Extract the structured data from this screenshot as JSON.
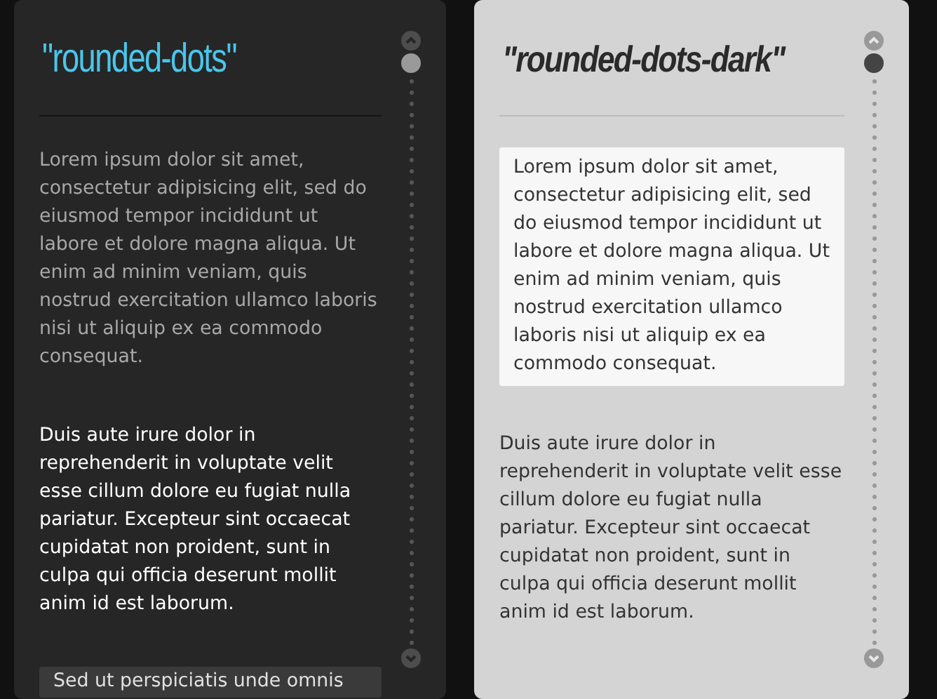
{
  "panels": [
    {
      "kind": "dark",
      "title": "\"rounded-dots\"",
      "blocks": [
        {
          "kind": "muted",
          "text": "Lorem ipsum dolor sit amet, consectetur adipisicing elit, sed do eiusmod tempor incididunt ut labore et dolore magna aliqua. Ut enim ad minim veniam, quis nostrud exercitation ullamco laboris nisi ut aliquip ex ea commodo consequat."
        },
        {
          "kind": "plain",
          "text": "Duis aute irure dolor in reprehenderit in voluptate velit esse cillum dolore eu fugiat nulla pariatur. Excepteur sint occaecat cupidatat non proident, sunt in culpa qui officia deserunt mollit anim id est laborum."
        },
        {
          "kind": "boxed",
          "text": "Sed ut perspiciatis unde omnis"
        }
      ]
    },
    {
      "kind": "light",
      "title": "\"rounded-dots-dark\"",
      "blocks": [
        {
          "kind": "boxed",
          "text": "Lorem ipsum dolor sit amet, consectetur adipisicing elit, sed do eiusmod tempor incididunt ut labore et dolore magna aliqua. Ut enim ad minim veniam, quis nostrud exercitation ullamco laboris nisi ut aliquip ex ea commodo consequat."
        },
        {
          "kind": "plain",
          "text": "Duis aute irure dolor in reprehenderit in voluptate velit esse cillum dolore eu fugiat nulla pariatur. Excepteur sint occaecat cupidatat non proident, sunt in culpa qui officia deserunt mollit anim id est laborum."
        }
      ]
    }
  ]
}
